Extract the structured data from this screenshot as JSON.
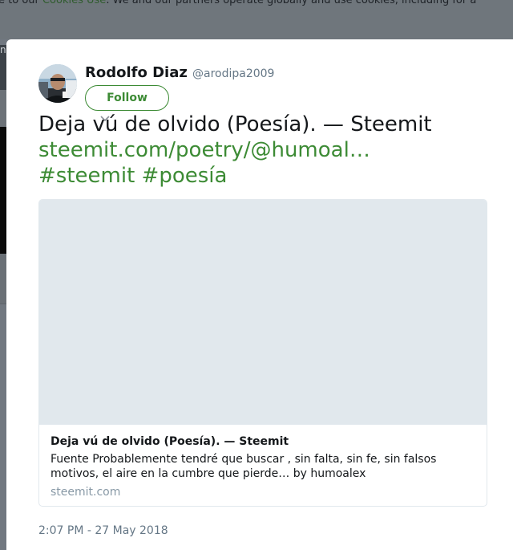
{
  "background": {
    "cookie_bar": {
      "lead_text": "e to our ",
      "link_text": "Cookies Use",
      "trail_text": ". We and our partners operate globally and use cookies, including for a"
    },
    "edge_char": "n"
  },
  "tweet": {
    "user": {
      "name": "Rodolfo Diaz",
      "handle": "@arodipa2009"
    },
    "follow_label": "Follow",
    "text_line1": "Deja vú de olvido (Poesía). — Steemit",
    "link": "steemit.com/poetry/@humoal…",
    "hashtags": [
      "#steemit",
      "#poesía"
    ],
    "card": {
      "title": "Deja vú de olvido (Poesía). — Steemit",
      "description": "Fuente Probablemente tendré que buscar , sin falta, sin fe, sin falsos motivos, el aire en la cumbre que pierde… by humoalex",
      "domain": "steemit.com"
    },
    "timestamp": "2:07 PM - 27 May 2018"
  },
  "colors": {
    "accent": "#3d8b35",
    "overlay": "#717880",
    "muted": "#657786"
  },
  "icons": {
    "avatar": "profile-photo",
    "chevron": "chevron-down-icon"
  }
}
